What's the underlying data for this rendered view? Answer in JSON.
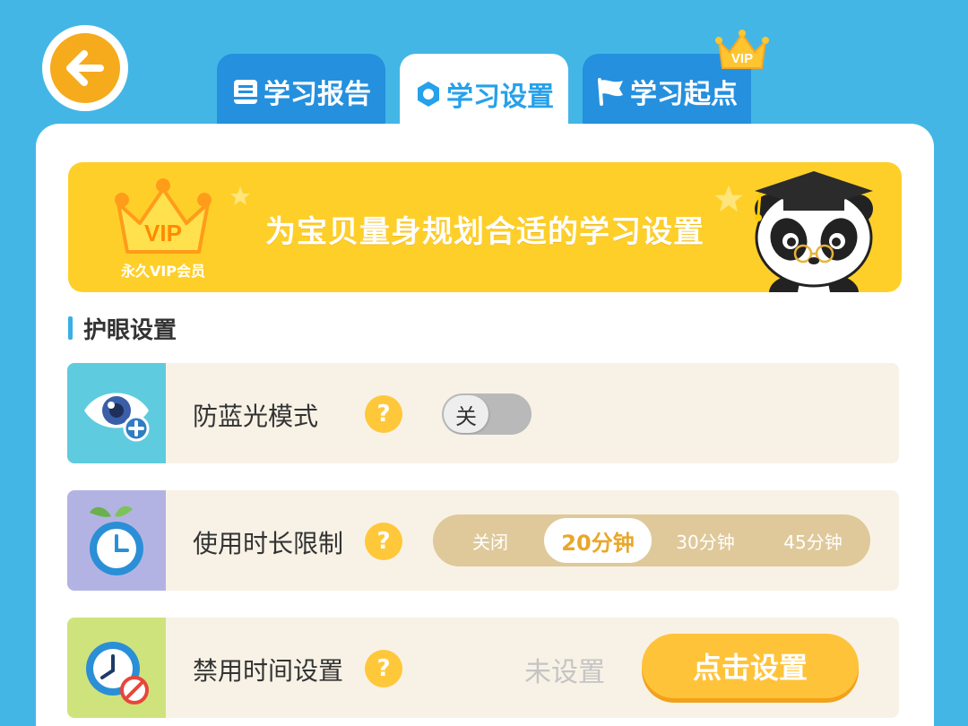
{
  "tabs": [
    {
      "label": "学习报告",
      "icon": "report-book-icon"
    },
    {
      "label": "学习设置",
      "icon": "settings-hex-icon",
      "active": true
    },
    {
      "label": "学习起点",
      "icon": "flag-icon",
      "badge": "VIP"
    }
  ],
  "banner": {
    "title": "为宝贝量身规划合适的学习设置",
    "vip_logo_text": "VIP",
    "vip_member_label": "永久VIP会员"
  },
  "section": {
    "title": "护眼设置"
  },
  "rows": {
    "blue_light": {
      "label": "防蓝光模式",
      "help": "?",
      "toggle_label": "关",
      "toggle_on": false
    },
    "time_limit": {
      "label": "使用时长限制",
      "help": "?",
      "options": [
        "关闭",
        "20分钟",
        "30分钟",
        "45分钟"
      ],
      "selected": "20分钟"
    },
    "forbidden_time": {
      "label": "禁用时间设置",
      "help": "?",
      "status": "未设置",
      "button_label": "点击设置"
    }
  },
  "colors": {
    "background": "#43b6e6",
    "tab_inactive": "#2590de",
    "accent_orange": "#f6ab1c",
    "banner_yellow": "#ffcf29",
    "row_bg": "#f8f2e6"
  }
}
